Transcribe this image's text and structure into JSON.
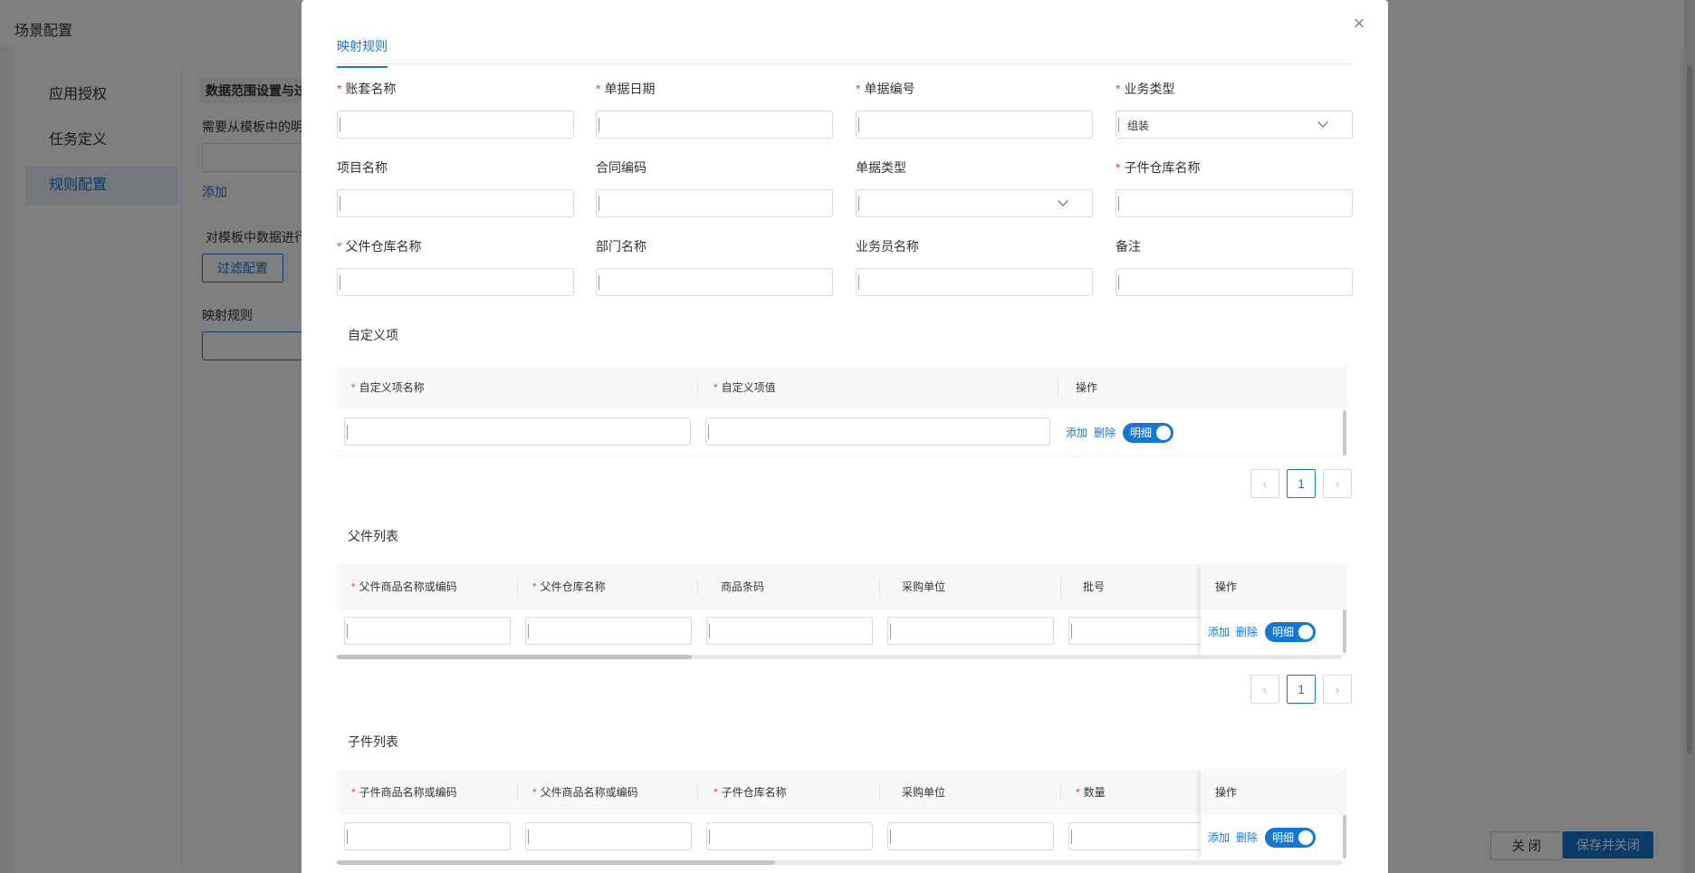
{
  "background": {
    "title": "场景配置",
    "sidebar": [
      "应用授权",
      "任务定义",
      "规则配置"
    ],
    "section_title": "数据范围设置与过",
    "hint1": "需要从模板中的明",
    "add_link": "添加",
    "hint2": "对模板中数据进行",
    "filter_button": "过滤配置",
    "mapping_label": "映射规则",
    "footer": {
      "close": "关 闭",
      "save_close": "保存并关闭"
    }
  },
  "modal": {
    "close_icon": "×",
    "tab": "映射规则",
    "fields": [
      {
        "label": "账套名称",
        "required": true
      },
      {
        "label": "单据日期",
        "required": true
      },
      {
        "label": "单据编号",
        "required": true
      },
      {
        "label": "业务类型",
        "required": true,
        "select": true,
        "value": "组装"
      },
      {
        "label": "项目名称",
        "required": false
      },
      {
        "label": "合同编码",
        "required": false
      },
      {
        "label": "单据类型",
        "required": false,
        "select": true,
        "value": ""
      },
      {
        "label": "子件仓库名称",
        "required": true
      },
      {
        "label": "父件仓库名称",
        "required": true
      },
      {
        "label": "部门名称",
        "required": false
      },
      {
        "label": "业务员名称",
        "required": false
      },
      {
        "label": "备注",
        "required": false
      }
    ],
    "custom": {
      "title": "自定义项",
      "col1": "自定义项名称",
      "col2": "自定义项值",
      "col_op": "操作",
      "add": "添加",
      "delete": "删除",
      "toggle": "明细",
      "page": "1"
    },
    "parent": {
      "title": "父件列表",
      "cols": [
        "父件商品名称或编码",
        "父件仓库名称",
        "商品条码",
        "采购单位",
        "批号"
      ],
      "required": [
        true,
        true,
        false,
        false,
        false
      ],
      "col_op": "操作",
      "add": "添加",
      "delete": "删除",
      "toggle": "明细",
      "page": "1"
    },
    "child": {
      "title": "子件列表",
      "cols": [
        "子件商品名称或编码",
        "父件商品名称或编码",
        "子件仓库名称",
        "采购单位",
        "数量"
      ],
      "required": [
        true,
        true,
        true,
        false,
        true
      ],
      "col_op": "操作",
      "add": "添加",
      "delete": "删除",
      "toggle": "明细"
    },
    "required_mark": "*",
    "pager_prev": "‹",
    "pager_next": "›"
  },
  "colors": {
    "accent": "#1677d2",
    "required": "#e94242"
  }
}
